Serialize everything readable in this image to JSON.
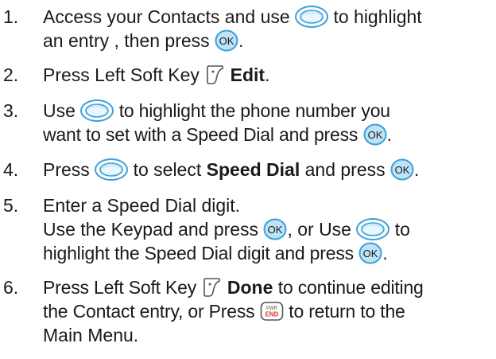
{
  "steps": [
    {
      "number": "1.",
      "l1a": "Access your Contacts and use",
      "l1b": "to highlight",
      "l2a": "an entry , then press",
      "l2b": "."
    },
    {
      "number": "2.",
      "l1a": "Press Left Soft Key",
      "l1bold": "Edit",
      "l1c": "."
    },
    {
      "number": "3.",
      "l1a": "Use",
      "l1b": "to highlight the phone number you",
      "l2a": "want to set with a Speed Dial and press",
      "l2b": "."
    },
    {
      "number": "4.",
      "l1a": "Press",
      "l1b": "to select",
      "l1bold": "Speed Dial",
      "l1c": "and press",
      "l1d": "."
    },
    {
      "number": "5.",
      "l1a": "Enter a Speed Dial digit.",
      "l2a": "Use the Keypad and press",
      "l2b": ", or Use",
      "l2c": "to",
      "l3a": "highlight the Speed Dial digit and press",
      "l3b": "."
    },
    {
      "number": "6.",
      "l1a": "Press Left Soft Key",
      "l1bold": "Done",
      "l1c": "to continue editing",
      "l2a": "the Contact entry, or Press",
      "l2b": "to return to the",
      "l3a": "Main Menu."
    }
  ],
  "icons": {
    "ok_label": "OK",
    "end_top": "PWR",
    "end_bottom": "END",
    "accent": "#3aa0d8",
    "accent_light": "#bfe3f6",
    "end_red": "#e0312a"
  }
}
